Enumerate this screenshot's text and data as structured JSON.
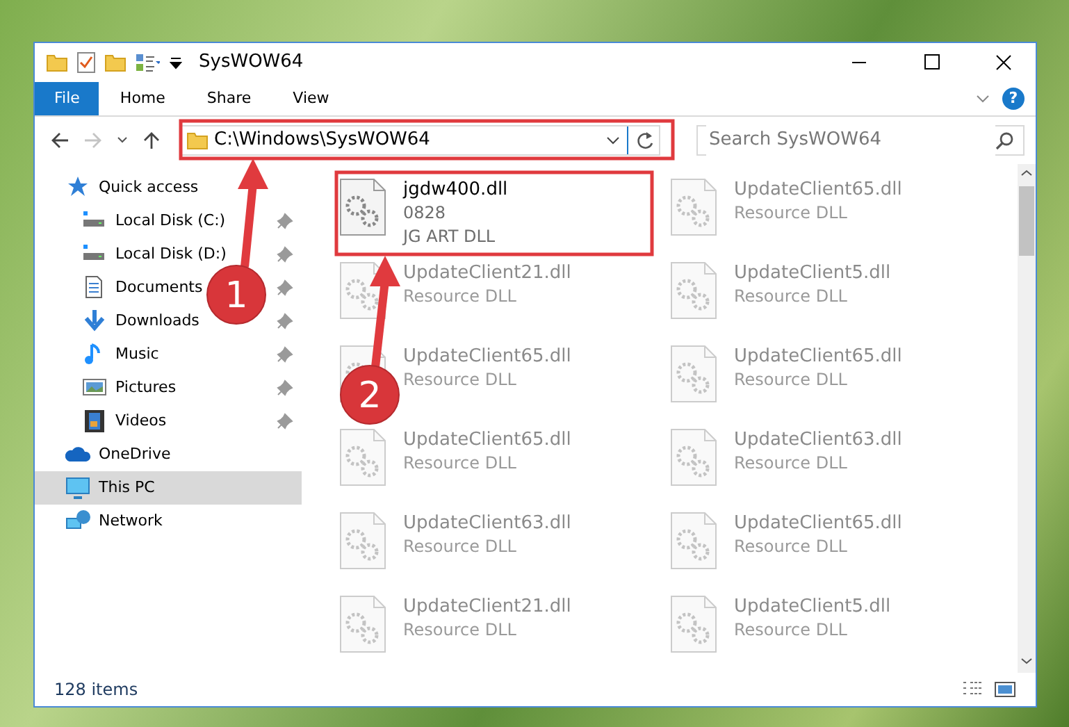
{
  "window": {
    "title": "SysWOW64"
  },
  "ribbon": {
    "tabs": [
      {
        "label": "File",
        "kind": "file"
      },
      {
        "label": "Home",
        "kind": "tab"
      },
      {
        "label": "Share",
        "kind": "tab"
      },
      {
        "label": "View",
        "kind": "tab"
      }
    ],
    "help": "?"
  },
  "navigation": {
    "forward_disabled": true,
    "address": "C:\\Windows\\SysWOW64",
    "search": {
      "placeholder": "Search SysWOW64"
    }
  },
  "sidebar": {
    "items": [
      {
        "label": "Quick access",
        "kind": "star",
        "selected": false,
        "children": [
          {
            "label": "Local Disk (C:)",
            "kind": "drive",
            "pinned": true,
            "selected": false
          },
          {
            "label": "Local Disk (D:)",
            "kind": "drive",
            "pinned": true,
            "selected": false
          },
          {
            "label": "Documents",
            "kind": "document",
            "pinned": true,
            "selected": false
          },
          {
            "label": "Downloads",
            "kind": "download",
            "pinned": true,
            "selected": false
          },
          {
            "label": "Music",
            "kind": "music",
            "pinned": true,
            "selected": false
          },
          {
            "label": "Pictures",
            "kind": "picture",
            "pinned": true,
            "selected": false
          },
          {
            "label": "Videos",
            "kind": "video",
            "pinned": true,
            "selected": false
          }
        ]
      },
      {
        "label": "OneDrive",
        "kind": "cloud",
        "selected": false
      },
      {
        "label": "This PC",
        "kind": "pc",
        "selected": true
      },
      {
        "label": "Network",
        "kind": "network",
        "selected": false
      }
    ]
  },
  "files": [
    {
      "name": "jgdw400.dll",
      "lines": [
        "0828",
        "JG ART DLL"
      ],
      "blurred": false
    },
    {
      "name": "UpdateClient65.dll",
      "lines": [
        "Resource DLL"
      ],
      "blurred": true
    },
    {
      "name": "UpdateClient21.dll",
      "lines": [
        "Resource DLL"
      ],
      "blurred": true
    },
    {
      "name": "UpdateClient5.dll",
      "lines": [
        "Resource DLL"
      ],
      "blurred": true
    },
    {
      "name": "UpdateClient65.dll",
      "lines": [
        "Resource DLL"
      ],
      "blurred": true
    },
    {
      "name": "UpdateClient65.dll",
      "lines": [
        "Resource DLL"
      ],
      "blurred": true
    },
    {
      "name": "UpdateClient65.dll",
      "lines": [
        "Resource DLL"
      ],
      "blurred": true
    },
    {
      "name": "UpdateClient63.dll",
      "lines": [
        "Resource DLL"
      ],
      "blurred": true
    },
    {
      "name": "UpdateClient63.dll",
      "lines": [
        "Resource DLL"
      ],
      "blurred": true
    },
    {
      "name": "UpdateClient65.dll",
      "lines": [
        "Resource DLL"
      ],
      "blurred": true
    },
    {
      "name": "UpdateClient21.dll",
      "lines": [
        "Resource DLL"
      ],
      "blurred": true
    },
    {
      "name": "UpdateClient5.dll",
      "lines": [
        "Resource DLL"
      ],
      "blurred": true
    }
  ],
  "status_bar": {
    "count": "128 items"
  },
  "annotations": [
    {
      "number": "1"
    },
    {
      "number": "2"
    }
  ]
}
